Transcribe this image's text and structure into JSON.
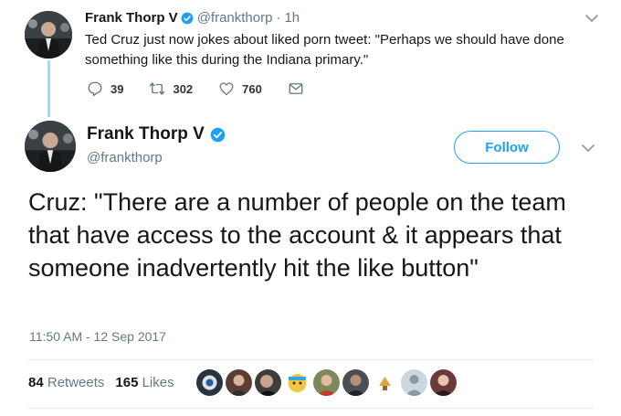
{
  "quoted_tweet": {
    "author_name": "Frank Thorp V",
    "handle": "@frankthorp",
    "separator": "·",
    "time_ago": "1h",
    "text": "Ted Cruz just now jokes about liked porn tweet: \"Perhaps we should have done something like this during the Indiana primary.\"",
    "reply_count": "39",
    "retweet_count": "302",
    "like_count": "760",
    "icons": [
      "reply-icon",
      "retweet-icon",
      "heart-icon",
      "message-icon",
      "chevron-down-icon",
      "verified-badge-icon"
    ]
  },
  "main_tweet": {
    "author_name": "Frank Thorp V",
    "handle": "@frankthorp",
    "follow_label": "Follow",
    "text": "Cruz: \"There are a number of people on the team that have access to the account & it appears that someone inadvertently hit the like button\"",
    "timestamp": "11:50 AM - 12 Sep 2017",
    "retweets_count": "84",
    "retweets_label": "Retweets",
    "likes_count": "165",
    "likes_label": "Likes"
  },
  "colors": {
    "accent": "#1da1f2",
    "thread_line": "#a4d9f4",
    "muted_text": "#657786",
    "divider": "#e6ecf0"
  }
}
